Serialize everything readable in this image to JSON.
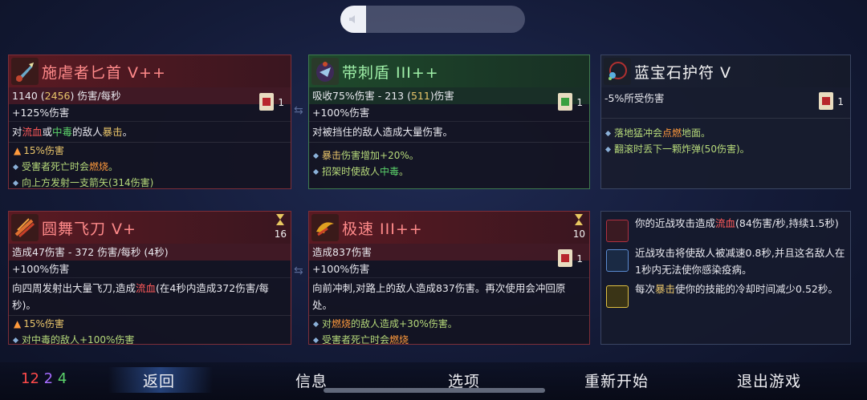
{
  "cards": {
    "c1": {
      "title": "施虐者匕首 V++",
      "stat1_a": "1140 (",
      "stat1_b": "2456",
      "stat1_c": ") 伤害/每秒",
      "stat2": "+125%伤害",
      "scroll_count": "1",
      "desc_a": "对",
      "desc_b": "流血",
      "desc_c": "或",
      "desc_d": "中毒",
      "desc_e": "的敌人",
      "desc_f": "暴击",
      "desc_g": "。",
      "bonus1": "15%伤害",
      "bonus2_a": "受害者死亡时会",
      "bonus2_b": "燃烧",
      "bonus2_c": "。",
      "bonus3": "向上方发射一支箭矢(314伤害)"
    },
    "c2": {
      "title": "带刺盾 III++",
      "stat1_a": "吸收75%伤害 - 213 (",
      "stat1_b": "511",
      "stat1_c": ")伤害",
      "stat2": "+100%伤害",
      "scroll_count": "1",
      "desc": "对被挡住的敌人造成大量伤害。",
      "bonus1_a": "暴击",
      "bonus1_b": "伤害增加+20%。",
      "bonus2_a": "招架时使敌人",
      "bonus2_b": "中毒",
      "bonus2_c": "。"
    },
    "c3": {
      "title": "蓝宝石护符 V",
      "stat1": "-5%所受伤害",
      "scroll_count": "1",
      "bonus1_a": "落地猛冲会",
      "bonus1_b": "点燃",
      "bonus1_c": "地面。",
      "bonus2": "翻滚时丢下一颗炸弹(50伤害)。"
    },
    "c4": {
      "title": "圆舞飞刀 V+",
      "timer": "16",
      "stat1": "造成47伤害 - 372 伤害/每秒 (4秒)",
      "stat2": "+100%伤害",
      "desc_a": "向四周发射出大量飞刀,造成",
      "desc_b": "流血",
      "desc_c": "(在4秒内造成372伤害/每秒)。",
      "bonus1": "15%伤害",
      "bonus2": "对中毒的敌人+100%伤害"
    },
    "c5": {
      "title": "极速 III++",
      "timer": "10",
      "stat1": "造成837伤害",
      "stat2": "+100%伤害",
      "scroll_count": "1",
      "desc": "向前冲刺,对路上的敌人造成837伤害。再次使用会冲回原处。",
      "bonus1_a": "对",
      "bonus1_b": "燃烧",
      "bonus1_c": "的敌人造成+30%伤害。",
      "bonus2_a": "受害者死亡时会",
      "bonus2_b": "燃烧"
    }
  },
  "passives": [
    {
      "a": "你的近战攻击造成",
      "b": "流血",
      "c": "(84伤害/秒,持续1.5秒)"
    },
    {
      "a": "近战攻击将使敌人被减速0.8秒,并且这名敌人在1秒内无法使你感染疫病。",
      "b": "",
      "c": ""
    },
    {
      "a": "每次",
      "b": "暴击",
      "c": "使你的技能的冷却时间减少0.52秒。"
    }
  ],
  "stats": {
    "red": "12",
    "purple": "2",
    "green": "4"
  },
  "menu": {
    "back": "返回",
    "info": "信息",
    "options": "选项",
    "restart": "重新开始",
    "quit": "退出游戏"
  },
  "colors": {
    "brutality": "#ff4a4a",
    "tactics": "#a66cff",
    "survival": "#5bd36a",
    "accent_yellow": "#e9c56a"
  },
  "icons": [
    "speaker-icon",
    "dagger-icon",
    "spiked-shield-icon",
    "amulet-icon",
    "throwing-knives-icon",
    "speed-icon",
    "scroll-icon",
    "hourglass-icon",
    "bleed-icon",
    "slow-icon",
    "crit-icon"
  ]
}
